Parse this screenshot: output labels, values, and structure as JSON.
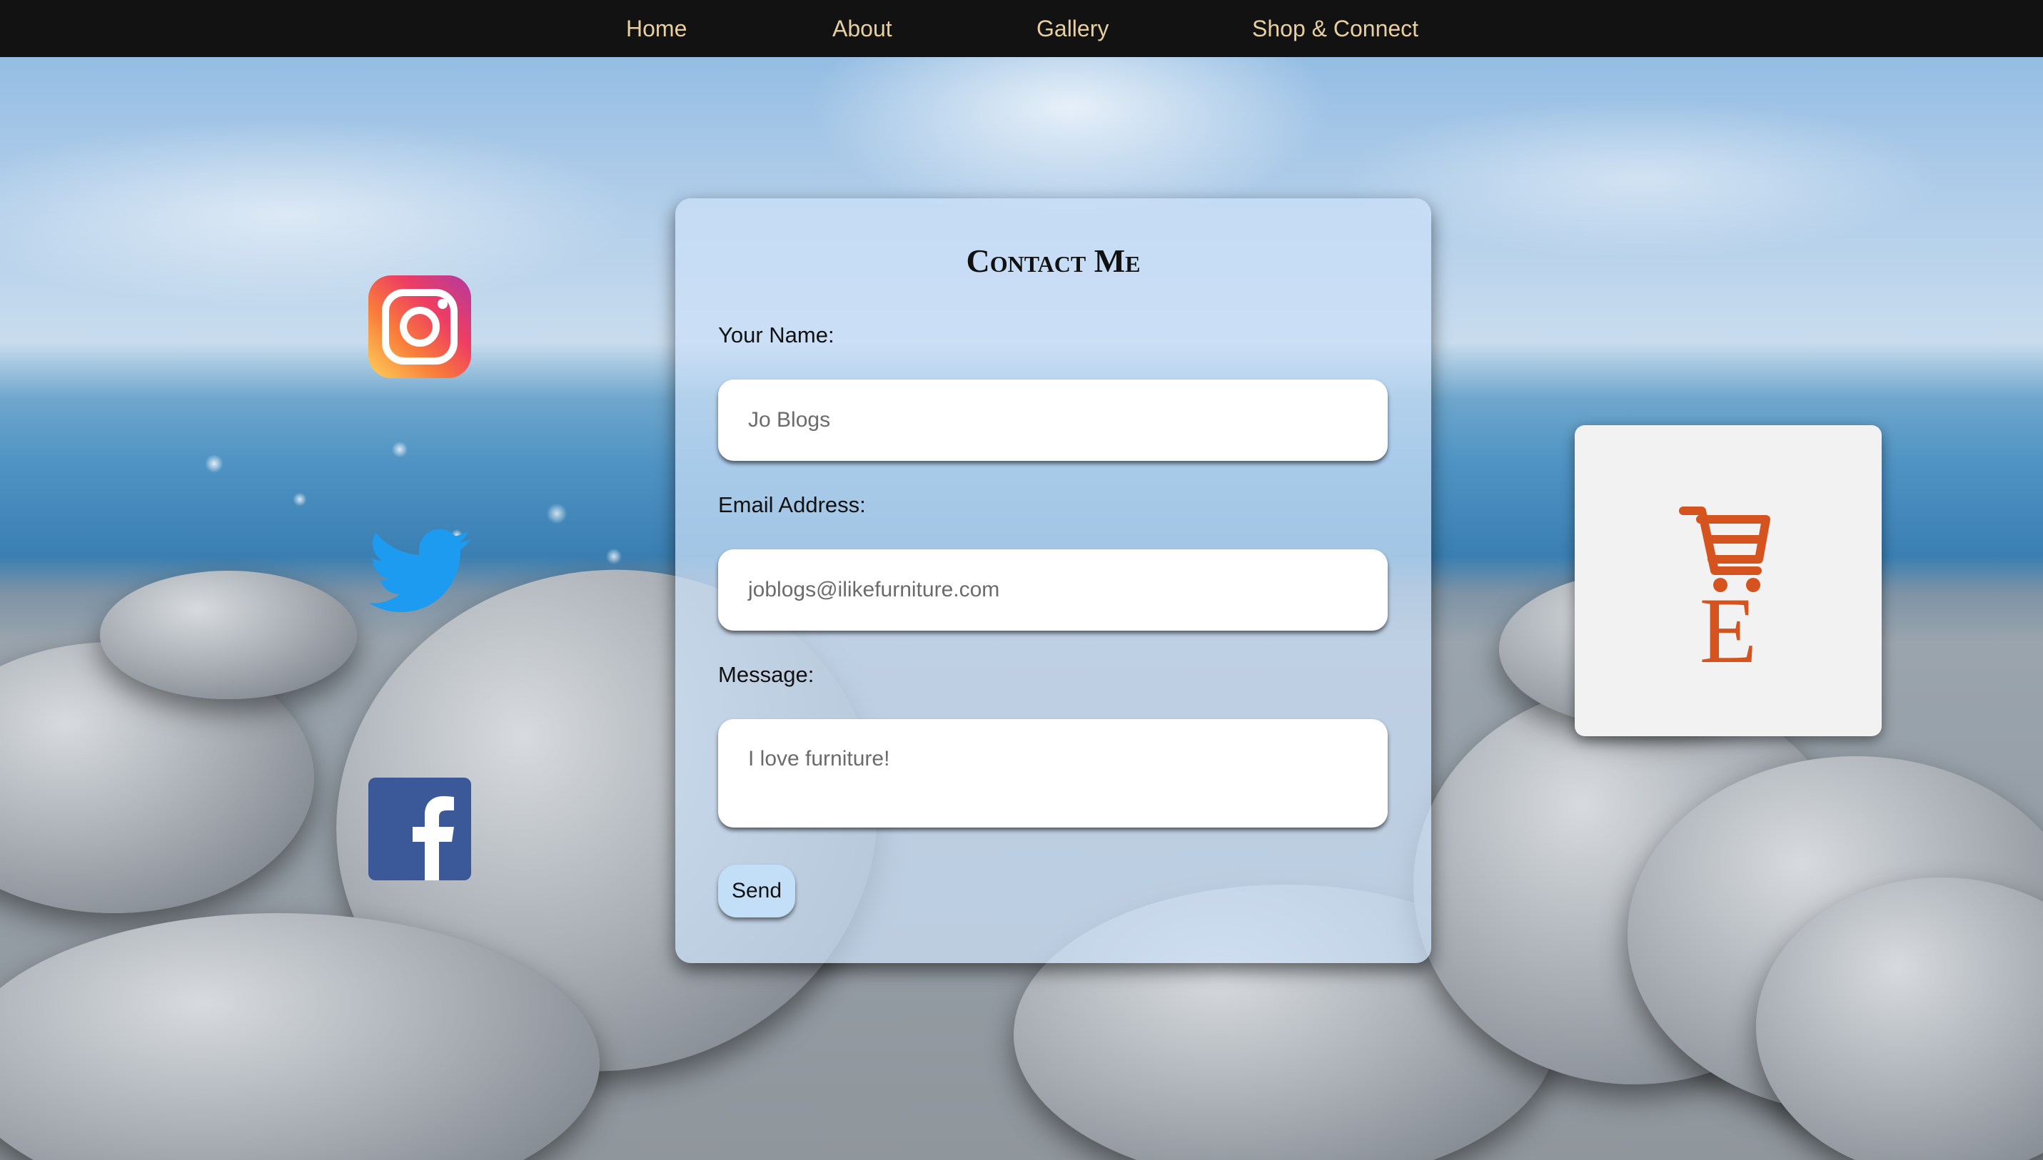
{
  "nav": {
    "items": [
      {
        "label": "Home"
      },
      {
        "label": "About"
      },
      {
        "label": "Gallery"
      },
      {
        "label": "Shop & Connect"
      }
    ]
  },
  "social": {
    "icons": [
      "instagram-icon",
      "twitter-icon",
      "facebook-icon"
    ]
  },
  "contact": {
    "title": "Contact Me",
    "name_label": "Your Name:",
    "name_placeholder": "Jo Blogs",
    "email_label": "Email Address:",
    "email_placeholder": "joblogs@ilikefurniture.com",
    "message_label": "Message:",
    "message_placeholder": "I love furniture!",
    "send_label": "Send"
  },
  "shop": {
    "icon": "etsy-cart-icon",
    "letter": "E"
  },
  "colors": {
    "nav_background": "#121212",
    "nav_text": "#e8cfa0",
    "etsy_orange": "#d5531f",
    "twitter_blue": "#1d9bf0",
    "facebook_blue": "#3b5998",
    "send_button": "#c3def7"
  }
}
